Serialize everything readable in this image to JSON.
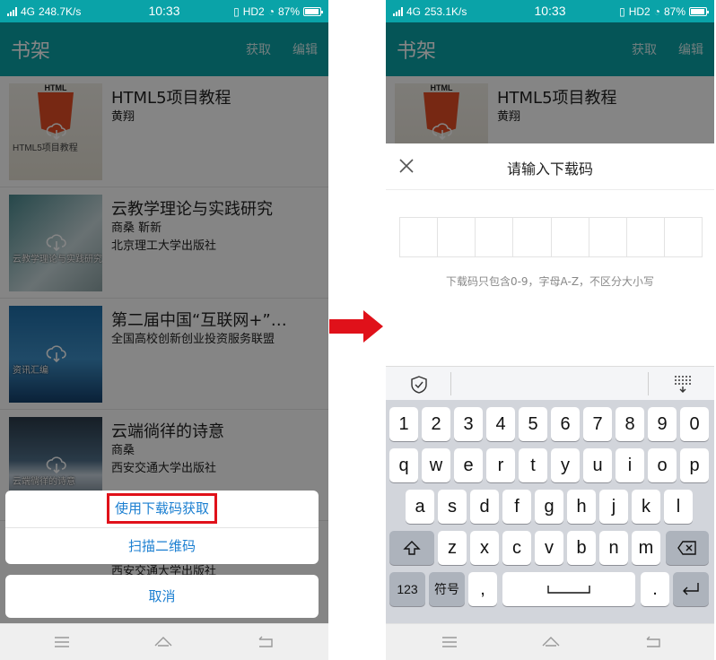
{
  "status_left": {
    "network": "4G",
    "speed": "248.7K/s",
    "time": "10:33",
    "hd": "HD2",
    "battery": "87%"
  },
  "status_right": {
    "network": "4G",
    "speed": "253.1K/s",
    "time": "10:33",
    "hd": "HD2",
    "battery": "87%"
  },
  "appbar": {
    "title": "书架",
    "get": "获取",
    "edit": "编辑"
  },
  "books": [
    {
      "title": "HTML5项目教程",
      "line1": "黄翔",
      "line2": "",
      "cover_text": "HTML5项目教程",
      "cover_tag": "HTML"
    },
    {
      "title": "云教学理论与实践研究",
      "line1": "商桑 靳新",
      "line2": "北京理工大学出版社",
      "cover_text": "云教学理论与实践研究"
    },
    {
      "title": "第二届中国“互联网+”…",
      "line1": "全国高校创新创业投资服务联盟",
      "line2": "",
      "cover_text": "资讯汇编"
    },
    {
      "title": "云端徜徉的诗意",
      "line1": "商桑",
      "line2": "西安交通大学出版社",
      "cover_text": "云端徜徉的诗意"
    }
  ],
  "hidden_publisher_peek": "西安交通大学出版社",
  "action_sheet": {
    "use_code": "使用下载码获取",
    "scan_qr": "扫描二维码",
    "cancel": "取消"
  },
  "dialog": {
    "title": "请输入下载码",
    "hint": "下载码只包含0-9，字母A-Z，不区分大小写",
    "box_count": 8
  },
  "keyboard": {
    "row_numbers": [
      "1",
      "2",
      "3",
      "4",
      "5",
      "6",
      "7",
      "8",
      "9",
      "0"
    ],
    "row1": [
      "q",
      "w",
      "e",
      "r",
      "t",
      "y",
      "u",
      "i",
      "o",
      "p"
    ],
    "row2": [
      "a",
      "s",
      "d",
      "f",
      "g",
      "h",
      "j",
      "k",
      "l"
    ],
    "row3": [
      "z",
      "x",
      "c",
      "v",
      "b",
      "n",
      "m"
    ],
    "key_123": "123",
    "key_symbols": "符号",
    "key_comma": ",",
    "key_period": "."
  },
  "colors": {
    "brand": "#0aa3a8",
    "link": "#1b7fd1",
    "highlight": "#e0111a",
    "arrow": "#e0111a"
  }
}
